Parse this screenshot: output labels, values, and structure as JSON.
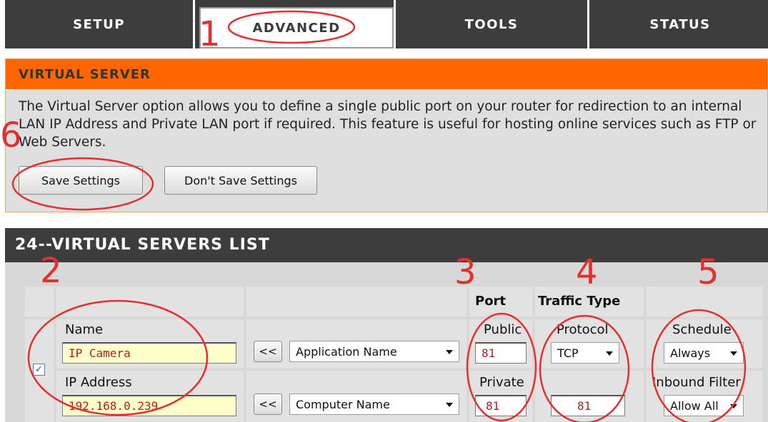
{
  "tabs": [
    {
      "label": "SETUP"
    },
    {
      "label": "ADVANCED"
    },
    {
      "label": "TOOLS"
    },
    {
      "label": "STATUS"
    }
  ],
  "virtual_server": {
    "title": "VIRTUAL SERVER",
    "description": "The Virtual Server option allows you to define a single public port on your router for redirection to an internal LAN IP Address and Private LAN port if required. This feature is useful for hosting online services such as FTP or Web Servers.",
    "save_label": "Save Settings",
    "dont_save_label": "Don't Save Settings"
  },
  "servers_list": {
    "title": "24--VIRTUAL SERVERS LIST",
    "header_port": "Port",
    "header_traffic": "Traffic Type",
    "row": {
      "checked": true,
      "name_label": "Name",
      "name_value": "IP Camera",
      "ip_label": "IP Address",
      "ip_value": "192.168.0.239",
      "arrow_label": "<<",
      "app_select": "Application Name",
      "computer_select": "Computer Name",
      "public_label": "Public",
      "public_value": "81",
      "private_label": "Private",
      "private_value": "81",
      "protocol_label": "Protocol",
      "protocol_value": "TCP",
      "protocol_number": "81",
      "schedule_label": "Schedule",
      "schedule_value": "Always",
      "inbound_label": "Inbound Filter",
      "inbound_value": "Allow All"
    }
  },
  "annotations": [
    "1",
    "2",
    "3",
    "4",
    "5",
    "6"
  ],
  "colors": {
    "orange_header": "#ff6600",
    "dark_bar": "#3d3d3d",
    "annotation_red": "#e23030",
    "field_yellow": "#ffffcc"
  }
}
